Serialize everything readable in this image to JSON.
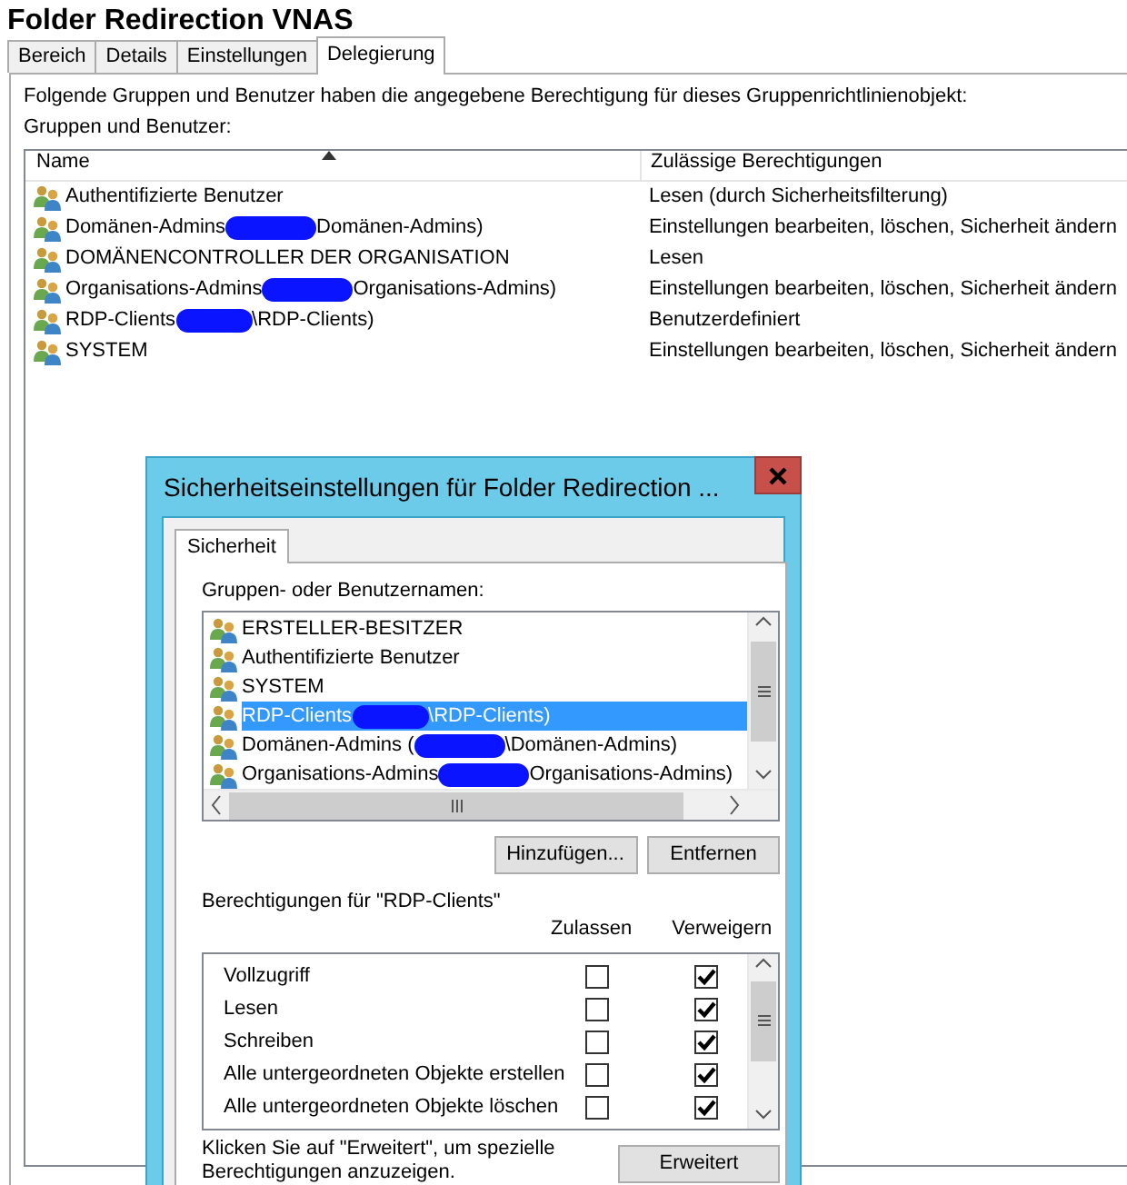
{
  "window": {
    "title": "Folder Redirection VNAS"
  },
  "tabs": [
    {
      "label": "Bereich",
      "selected": false
    },
    {
      "label": "Details",
      "selected": false
    },
    {
      "label": "Einstellungen",
      "selected": false
    },
    {
      "label": "Delegierung",
      "selected": true
    }
  ],
  "delegation": {
    "intro": "Folgende Gruppen und Benutzer haben die angegebene Berechtigung für dieses Gruppenrichtlinienobjekt:",
    "list_label": "Gruppen und Benutzer:",
    "columns": [
      {
        "label": "Name",
        "sorted": true
      },
      {
        "label": "Zulässige Berechtigungen",
        "sorted": false
      }
    ],
    "rows": [
      {
        "name": "Authentifizierte Benutzer",
        "redacted": false,
        "permission": "Lesen (durch Sicherheitsfilterung)"
      },
      {
        "name": "Domänen-Admins",
        "redacted": true,
        "name_rest": "Domänen-Admins)",
        "permission": "Einstellungen bearbeiten, löschen, Sicherheit ändern"
      },
      {
        "name": "DOMÄNENCONTROLLER DER ORGANISATION",
        "redacted": false,
        "permission": "Lesen"
      },
      {
        "name": "Organisations-Admins",
        "redacted": true,
        "name_rest": "Organisations-Admins)",
        "permission": "Einstellungen bearbeiten, löschen, Sicherheit ändern"
      },
      {
        "name": "RDP-Clients",
        "redacted": true,
        "name_rest": "\\RDP-Clients)",
        "permission": "Benutzerdefiniert"
      },
      {
        "name": "SYSTEM",
        "redacted": false,
        "permission": "Einstellungen bearbeiten, löschen, Sicherheit ändern"
      }
    ]
  },
  "dialog": {
    "title": "Sicherheitseinstellungen für Folder Redirection ...",
    "tabs": [
      {
        "label": "Sicherheit",
        "selected": true
      }
    ],
    "groups_label": "Gruppen- oder Benutzernamen:",
    "groups": [
      {
        "name": "ERSTELLER-BESITZER",
        "redacted": false,
        "selected": false
      },
      {
        "name": "Authentifizierte Benutzer",
        "redacted": false,
        "selected": false
      },
      {
        "name": "SYSTEM",
        "redacted": false,
        "selected": false
      },
      {
        "name": "RDP-Clients",
        "redacted": true,
        "name_rest": "\\RDP-Clients)",
        "selected": true
      },
      {
        "name": "Domänen-Admins (",
        "redacted": true,
        "name_rest": "\\Domänen-Admins)",
        "selected": false
      },
      {
        "name": "Organisations-Admins",
        "redacted": true,
        "name_rest": "Organisations-Admins)",
        "selected": false
      }
    ],
    "add_button": "Hinzufügen...",
    "remove_button": "Entfernen",
    "permissions_label": "Berechtigungen für \"RDP-Clients\"",
    "permission_columns": [
      "Zulassen",
      "Verweigern"
    ],
    "permissions": [
      {
        "name": "Vollzugriff",
        "allow": false,
        "deny": true
      },
      {
        "name": "Lesen",
        "allow": false,
        "deny": true
      },
      {
        "name": "Schreiben",
        "allow": false,
        "deny": true
      },
      {
        "name": "Alle untergeordneten Objekte erstellen",
        "allow": false,
        "deny": true
      },
      {
        "name": "Alle untergeordneten Objekte löschen",
        "allow": false,
        "deny": true
      }
    ],
    "advanced_hint": "Klicken Sie auf \"Erweitert\", um spezielle Berechtigungen anzuzeigen.",
    "advanced_button": "Erweitert"
  }
}
